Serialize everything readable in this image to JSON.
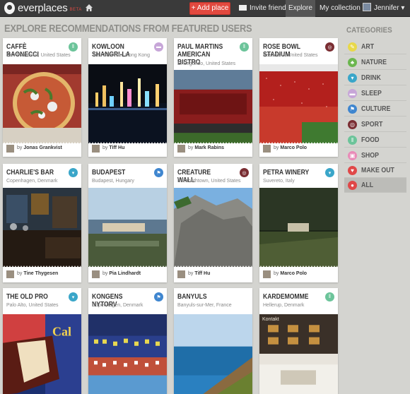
{
  "app": {
    "name": "everplaces",
    "beta": "BETA"
  },
  "topbar": {
    "add_place": "+ Add place",
    "invite": "Invite friends",
    "explore": "Explore",
    "collection": "My collection",
    "user": "Jennifer ▾"
  },
  "heading": "EXPLORE RECOMMENDATIONS FROM FEATURED USERS",
  "categories": {
    "title": "CATEGORIES",
    "items": [
      {
        "label": "ART",
        "color": "#e8d84a",
        "glyph": "✎"
      },
      {
        "label": "NATURE",
        "color": "#6bb64f",
        "glyph": "♣"
      },
      {
        "label": "DRINK",
        "color": "#3aa6c9",
        "glyph": "▾"
      },
      {
        "label": "SLEEP",
        "color": "#c7a6d8",
        "glyph": "▬"
      },
      {
        "label": "CULTURE",
        "color": "#3f86cf",
        "glyph": "⚑"
      },
      {
        "label": "SPORT",
        "color": "#7a2d32",
        "glyph": "◎"
      },
      {
        "label": "FOOD",
        "color": "#6cc49a",
        "glyph": "‖"
      },
      {
        "label": "SHOP",
        "color": "#e98bb8",
        "glyph": "▣"
      },
      {
        "label": "MAKE OUT",
        "color": "#e04848",
        "glyph": "♥"
      },
      {
        "label": "ALL",
        "color": "#e04848",
        "glyph": "●"
      }
    ]
  },
  "cards": [
    {
      "title": "CAFFÈ BAONECCI",
      "loc": "San Francisco, United States",
      "by": "by",
      "user": "Jonas Grankvist",
      "badge_color": "#6cc49a",
      "badge_glyph": "‖"
    },
    {
      "title": "KOWLOON SHANGRI-LA",
      "loc": "Tsim Sha Tsui, Hong Kong",
      "by": "by",
      "user": "Tiff Hu",
      "badge_color": "#c7a6d8",
      "badge_glyph": "▬"
    },
    {
      "title": "PAUL MARTINS AMERICAN BISTRO",
      "loc": "El Segundo, United States",
      "by": "by",
      "user": "Mark Rabins",
      "badge_color": "#6cc49a",
      "badge_glyph": "‖"
    },
    {
      "title": "ROSE BOWL STADIUM",
      "loc": "Pasadena, United States",
      "by": "by",
      "user": "Marco Polo",
      "badge_color": "#7a2d32",
      "badge_glyph": "◎"
    },
    {
      "title": "CHARLIE'S BAR",
      "loc": "Copenhagen, Denmark",
      "by": "by",
      "user": "Tine Thygesen",
      "badge_color": "#3aa6c9",
      "badge_glyph": "▾"
    },
    {
      "title": "BUDAPEST",
      "loc": "Budapest, Hungary",
      "by": "by",
      "user": "Pia Lindhardt",
      "badge_color": "#3f86cf",
      "badge_glyph": "⚑"
    },
    {
      "title": "CREATURE WALL",
      "loc": "Elizabethtown, United States",
      "by": "by",
      "user": "Tiff Hu",
      "badge_color": "#7a2d32",
      "badge_glyph": "◎"
    },
    {
      "title": "PETRA WINERY",
      "loc": "Suvereto, Italy",
      "by": "by",
      "user": "Marco Polo",
      "badge_color": "#3aa6c9",
      "badge_glyph": "▾"
    },
    {
      "title": "THE OLD PRO",
      "loc": "Palo Alto, United States",
      "by": "",
      "user": "",
      "badge_color": "#3aa6c9",
      "badge_glyph": "▾"
    },
    {
      "title": "KONGENS NYTORV",
      "loc": "Copenhagen, Denmark",
      "by": "",
      "user": "",
      "badge_color": "#3f86cf",
      "badge_glyph": "⚑"
    },
    {
      "title": "BANYULS",
      "loc": "Banyuls-sur-Mer, France",
      "by": "",
      "user": "",
      "badge_color": "",
      "badge_glyph": ""
    },
    {
      "title": "KARDEMOMME",
      "loc": "Hellerup, Denmark",
      "by": "",
      "user": "",
      "badge_color": "#6cc49a",
      "badge_glyph": "‖",
      "sign": "Kontakt"
    }
  ]
}
